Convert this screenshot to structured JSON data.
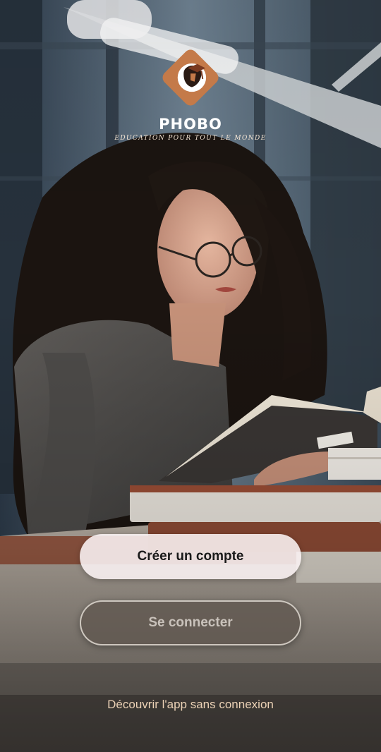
{
  "app": {
    "brand_name": "PHOBO",
    "tagline": "EDUCATION POUR TOUT LE MONDE",
    "logo_icon": "graduate-cap-logo-icon",
    "brand_color": "#c47a49"
  },
  "actions": {
    "create_account_label": "Créer un compte",
    "login_label": "Se connecter",
    "guest_label": "Découvrir l'app sans connexion"
  },
  "background": {
    "description_icon": "student-reading-photo"
  }
}
